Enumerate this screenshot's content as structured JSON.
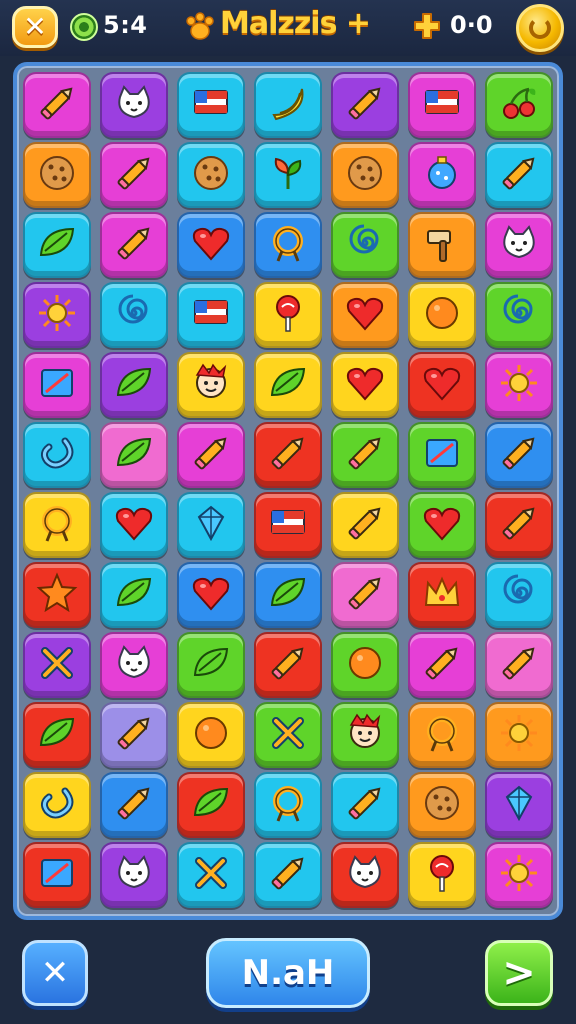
{
  "header": {
    "close_label": "✕",
    "timer": "5:4",
    "title": "Malzzis +",
    "score": "0·0",
    "timer_icon": "timer-icon",
    "title_icon": "paw-icon",
    "plus_icon": "plus-icon",
    "coin_icon": "coin-icon"
  },
  "colors": {
    "magenta": "#e63fd6",
    "purple": "#9b3fe0",
    "cyan": "#22c6ee",
    "blue": "#2f8ff0",
    "green": "#5fd42a",
    "yellow": "#ffd51e",
    "orange": "#ff9a1e",
    "red": "#ee3322",
    "pink": "#f06bd0",
    "lavender": "#9c8fe8"
  },
  "board": {
    "rows": [
      [
        {
          "c": "magenta",
          "i": "pencil"
        },
        {
          "c": "purple",
          "i": "cat"
        },
        {
          "c": "cyan",
          "i": "flag"
        },
        {
          "c": "cyan",
          "i": "banana"
        },
        {
          "c": "purple",
          "i": "pencil"
        },
        {
          "c": "magenta",
          "i": "flag"
        },
        {
          "c": "green",
          "i": "cherries"
        }
      ],
      [
        {
          "c": "orange",
          "i": "cookie"
        },
        {
          "c": "magenta",
          "i": "pencil"
        },
        {
          "c": "cyan",
          "i": "cookie"
        },
        {
          "c": "cyan",
          "i": "sprout"
        },
        {
          "c": "orange",
          "i": "cookie"
        },
        {
          "c": "magenta",
          "i": "ornament"
        },
        {
          "c": "cyan",
          "i": "pencil"
        }
      ],
      [
        {
          "c": "cyan",
          "i": "leaf"
        },
        {
          "c": "magenta",
          "i": "pencil"
        },
        {
          "c": "blue",
          "i": "heart"
        },
        {
          "c": "blue",
          "i": "ring"
        },
        {
          "c": "green",
          "i": "spiral"
        },
        {
          "c": "orange",
          "i": "hammer"
        },
        {
          "c": "magenta",
          "i": "cat"
        }
      ],
      [
        {
          "c": "purple",
          "i": "sun"
        },
        {
          "c": "cyan",
          "i": "spiral"
        },
        {
          "c": "cyan",
          "i": "flag"
        },
        {
          "c": "yellow",
          "i": "lollipop"
        },
        {
          "c": "orange",
          "i": "heart"
        },
        {
          "c": "yellow",
          "i": "orange"
        },
        {
          "c": "green",
          "i": "spiral"
        }
      ],
      [
        {
          "c": "magenta",
          "i": "square"
        },
        {
          "c": "purple",
          "i": "leaf"
        },
        {
          "c": "yellow",
          "i": "face"
        },
        {
          "c": "yellow",
          "i": "leaf"
        },
        {
          "c": "yellow",
          "i": "heart"
        },
        {
          "c": "red",
          "i": "heart"
        },
        {
          "c": "magenta",
          "i": "sun"
        }
      ],
      [
        {
          "c": "cyan",
          "i": "hook"
        },
        {
          "c": "pink",
          "i": "leaf"
        },
        {
          "c": "magenta",
          "i": "pencil"
        },
        {
          "c": "red",
          "i": "pencil"
        },
        {
          "c": "green",
          "i": "pencil"
        },
        {
          "c": "green",
          "i": "square"
        },
        {
          "c": "blue",
          "i": "pencil"
        }
      ],
      [
        {
          "c": "yellow",
          "i": "ring"
        },
        {
          "c": "cyan",
          "i": "heart"
        },
        {
          "c": "cyan",
          "i": "gem"
        },
        {
          "c": "red",
          "i": "flag"
        },
        {
          "c": "yellow",
          "i": "pencil"
        },
        {
          "c": "green",
          "i": "heart"
        },
        {
          "c": "red",
          "i": "pencil"
        }
      ],
      [
        {
          "c": "red",
          "i": "star"
        },
        {
          "c": "cyan",
          "i": "leaf"
        },
        {
          "c": "blue",
          "i": "heart"
        },
        {
          "c": "blue",
          "i": "leaf"
        },
        {
          "c": "pink",
          "i": "pencil"
        },
        {
          "c": "red",
          "i": "crown"
        },
        {
          "c": "cyan",
          "i": "spiral"
        }
      ],
      [
        {
          "c": "purple",
          "i": "cross"
        },
        {
          "c": "magenta",
          "i": "cat"
        },
        {
          "c": "green",
          "i": "leaf"
        },
        {
          "c": "red",
          "i": "pencil"
        },
        {
          "c": "green",
          "i": "orange"
        },
        {
          "c": "magenta",
          "i": "pencil"
        },
        {
          "c": "pink",
          "i": "pencil"
        }
      ],
      [
        {
          "c": "red",
          "i": "leaf"
        },
        {
          "c": "lavender",
          "i": "pencil"
        },
        {
          "c": "yellow",
          "i": "orange"
        },
        {
          "c": "green",
          "i": "cross"
        },
        {
          "c": "green",
          "i": "face"
        },
        {
          "c": "orange",
          "i": "ring"
        },
        {
          "c": "orange",
          "i": "sun"
        }
      ],
      [
        {
          "c": "yellow",
          "i": "hook"
        },
        {
          "c": "blue",
          "i": "pencil"
        },
        {
          "c": "red",
          "i": "leaf"
        },
        {
          "c": "cyan",
          "i": "ring"
        },
        {
          "c": "cyan",
          "i": "pencil"
        },
        {
          "c": "orange",
          "i": "cookie"
        },
        {
          "c": "purple",
          "i": "gem"
        }
      ],
      [
        {
          "c": "red",
          "i": "square"
        },
        {
          "c": "purple",
          "i": "cat"
        },
        {
          "c": "cyan",
          "i": "cross"
        },
        {
          "c": "cyan",
          "i": "pencil"
        },
        {
          "c": "red",
          "i": "cat"
        },
        {
          "c": "yellow",
          "i": "lollipop"
        },
        {
          "c": "magenta",
          "i": "sun"
        }
      ]
    ]
  },
  "footer": {
    "close_label": "✕",
    "main_label": "N.aH",
    "next_label": ">"
  }
}
